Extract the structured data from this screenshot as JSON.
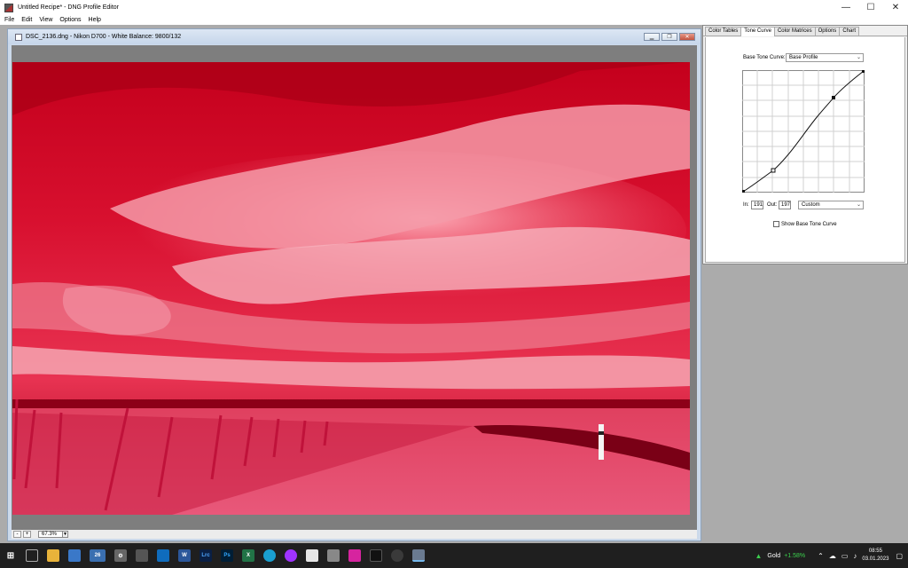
{
  "window": {
    "title": "Untitled Recipe* - DNG Profile Editor",
    "minimize": "—",
    "maximize": "☐",
    "close": "✕"
  },
  "menu": [
    "File",
    "Edit",
    "View",
    "Options",
    "Help"
  ],
  "document": {
    "title": "DSC_2136.dng - Nikon D700 - White Balance: 9800/132",
    "zoom": "67.3%"
  },
  "panel": {
    "tabs": [
      "Color Tables",
      "Tone Curve",
      "Color Matrices",
      "Options",
      "Chart"
    ],
    "active_tab": "Tone Curve",
    "base_tone_curve_label": "Base Tone Curve:",
    "base_tone_curve_value": "Base Profile",
    "in_label": "In:",
    "in_value": "191",
    "out_label": "Out:",
    "out_value": "197",
    "curve_preset": "Custom",
    "show_base_label": "Show Base Tone Curve",
    "show_base_checked": false
  },
  "taskbar": {
    "ticker_name": "Gold",
    "ticker_change": "+1.58%",
    "time": "08:55",
    "date": "03.01.2023",
    "badge": "26",
    "icons": [
      "windows-start-icon",
      "task-view-icon",
      "file-explorer-icon",
      "store-icon",
      "weather-icon",
      "settings-icon",
      "calculator-icon",
      "outlook-icon",
      "word-icon",
      "lightroom-icon",
      "photoshop-icon",
      "excel-icon",
      "edge-icon",
      "messenger-icon",
      "notes-icon",
      "photos-icon",
      "instagram-icon",
      "audio-icon",
      "edge-dev-icon",
      "dng-profile-editor-icon"
    ],
    "icon_labels": {
      "word": "W",
      "lightroom": "Lrc",
      "photoshop": "Ps",
      "excel": "X"
    }
  }
}
